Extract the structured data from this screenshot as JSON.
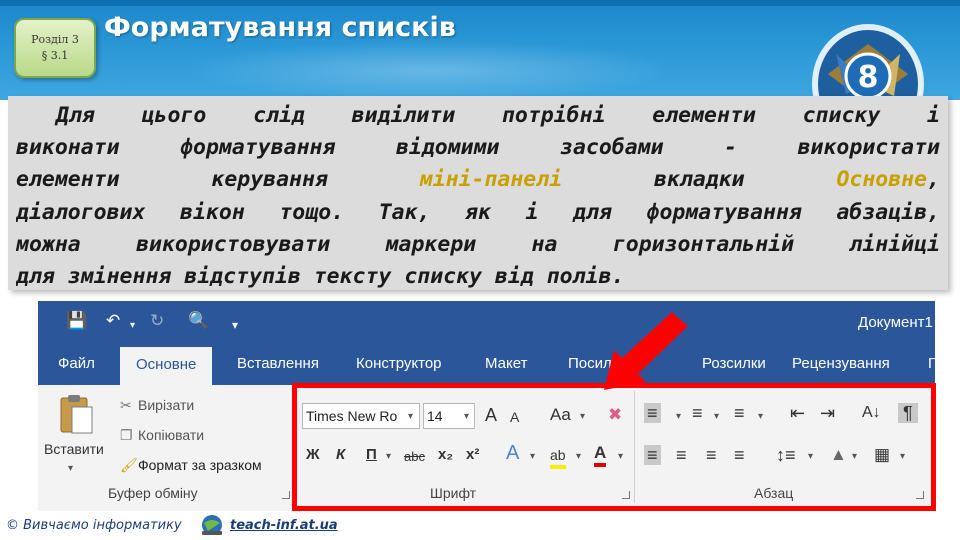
{
  "slide": {
    "badge_line1": "Розділ 3",
    "badge_line2": "§ 3.1",
    "title": "Форматування списків",
    "grade": "8"
  },
  "paragraph": {
    "line1": "Для цього слід виділити потрібні елементи списку і",
    "line2": "виконати форматування відомими засобами - використати",
    "line3_a": "елементи керування ",
    "line3_hl1": "міні-панелі",
    "line3_b": " вкладки ",
    "line3_hl2": "Основне",
    "line3_c": ",",
    "line4": "діалогових вікон тощо. Так, як і для форматування абзаців,",
    "line5": "можна використовувати маркери на горизонтальній лінійці",
    "line6": "для змінення відступів тексту списку від полів.",
    "highlight_color": "#c8a000"
  },
  "ribbon": {
    "doc_title": "Документ1",
    "tabs": [
      "Файл",
      "Основне",
      "Вставлення",
      "Конструктор",
      "Макет",
      "Посилання",
      "Розсилки",
      "Рецензування",
      "П"
    ],
    "active_tab": "Основне",
    "clipboard": {
      "paste": "Вставити",
      "cut": "Вирізати",
      "copy": "Копіювати",
      "format_painter": "Формат за зразком",
      "group_label": "Буфер обміну"
    },
    "font": {
      "font_name": "Times New Ro",
      "font_size": "14",
      "grow": "A",
      "shrink": "A",
      "change_case": "Aa",
      "bold": "Ж",
      "italic": "К",
      "underline": "П",
      "strikethrough": "abc",
      "subscript": "x₂",
      "superscript": "x²",
      "text_effects": "A",
      "highlight": "ab",
      "font_color": "A",
      "group_label": "Шрифт"
    },
    "paragraph_group": {
      "group_label": "Абзац",
      "show_marks": "¶"
    },
    "accent_color": "#2b579a",
    "frame_color": "#ff0000"
  },
  "footer": {
    "copyright": "© Вивчаємо інформатику",
    "link": "teach-inf.at.ua"
  }
}
